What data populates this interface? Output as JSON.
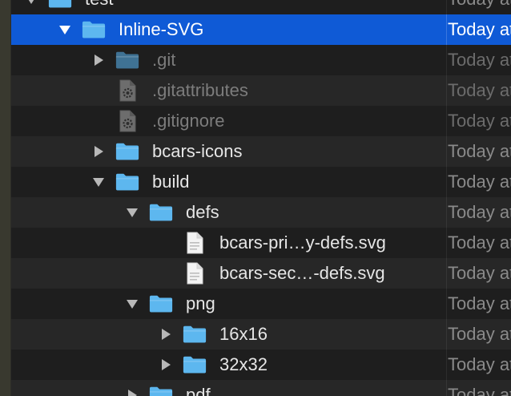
{
  "colors": {
    "selection": "#0f5ad6",
    "row_even": "#272727",
    "row_odd": "#1e1e1e",
    "folder": "#5db7ef",
    "folder_dim": "#3f7294",
    "text": "#e6e6e6",
    "text_dim": "#7c7c7c",
    "date": "#8a8a8a"
  },
  "files": [
    {
      "name": "test",
      "date": "Today at",
      "depth": 0,
      "icon": "folder-icon",
      "disclosure": "expanded",
      "dim": false,
      "selected": false
    },
    {
      "name": "Inline-SVG",
      "date": "Today at",
      "depth": 1,
      "icon": "folder-icon",
      "disclosure": "expanded",
      "dim": false,
      "selected": true
    },
    {
      "name": ".git",
      "date": "Today at",
      "depth": 2,
      "icon": "folder-icon",
      "disclosure": "collapsed",
      "dim": true,
      "selected": false
    },
    {
      "name": ".gitattributes",
      "date": "Today at",
      "depth": 2,
      "icon": "settings-file-icon",
      "disclosure": "none",
      "dim": true,
      "selected": false
    },
    {
      "name": ".gitignore",
      "date": "Today at",
      "depth": 2,
      "icon": "settings-file-icon",
      "disclosure": "none",
      "dim": true,
      "selected": false
    },
    {
      "name": "bcars-icons",
      "date": "Today at",
      "depth": 2,
      "icon": "folder-icon",
      "disclosure": "collapsed",
      "dim": false,
      "selected": false
    },
    {
      "name": "build",
      "date": "Today at",
      "depth": 2,
      "icon": "folder-icon",
      "disclosure": "expanded",
      "dim": false,
      "selected": false
    },
    {
      "name": "defs",
      "date": "Today at",
      "depth": 3,
      "icon": "folder-icon",
      "disclosure": "expanded",
      "dim": false,
      "selected": false
    },
    {
      "name": "bcars-pri…y-defs.svg",
      "date": "Today at",
      "depth": 4,
      "icon": "document-icon",
      "disclosure": "none",
      "dim": false,
      "selected": false
    },
    {
      "name": "bcars-sec…-defs.svg",
      "date": "Today at",
      "depth": 4,
      "icon": "document-icon",
      "disclosure": "none",
      "dim": false,
      "selected": false
    },
    {
      "name": "png",
      "date": "Today at",
      "depth": 3,
      "icon": "folder-icon",
      "disclosure": "expanded",
      "dim": false,
      "selected": false
    },
    {
      "name": "16x16",
      "date": "Today at",
      "depth": 4,
      "icon": "folder-icon",
      "disclosure": "collapsed",
      "dim": false,
      "selected": false
    },
    {
      "name": "32x32",
      "date": "Today at",
      "depth": 4,
      "icon": "folder-icon",
      "disclosure": "collapsed",
      "dim": false,
      "selected": false
    },
    {
      "name": "pdf",
      "date": "Today at",
      "depth": 3,
      "icon": "folder-icon",
      "disclosure": "collapsed",
      "dim": false,
      "selected": false
    }
  ]
}
